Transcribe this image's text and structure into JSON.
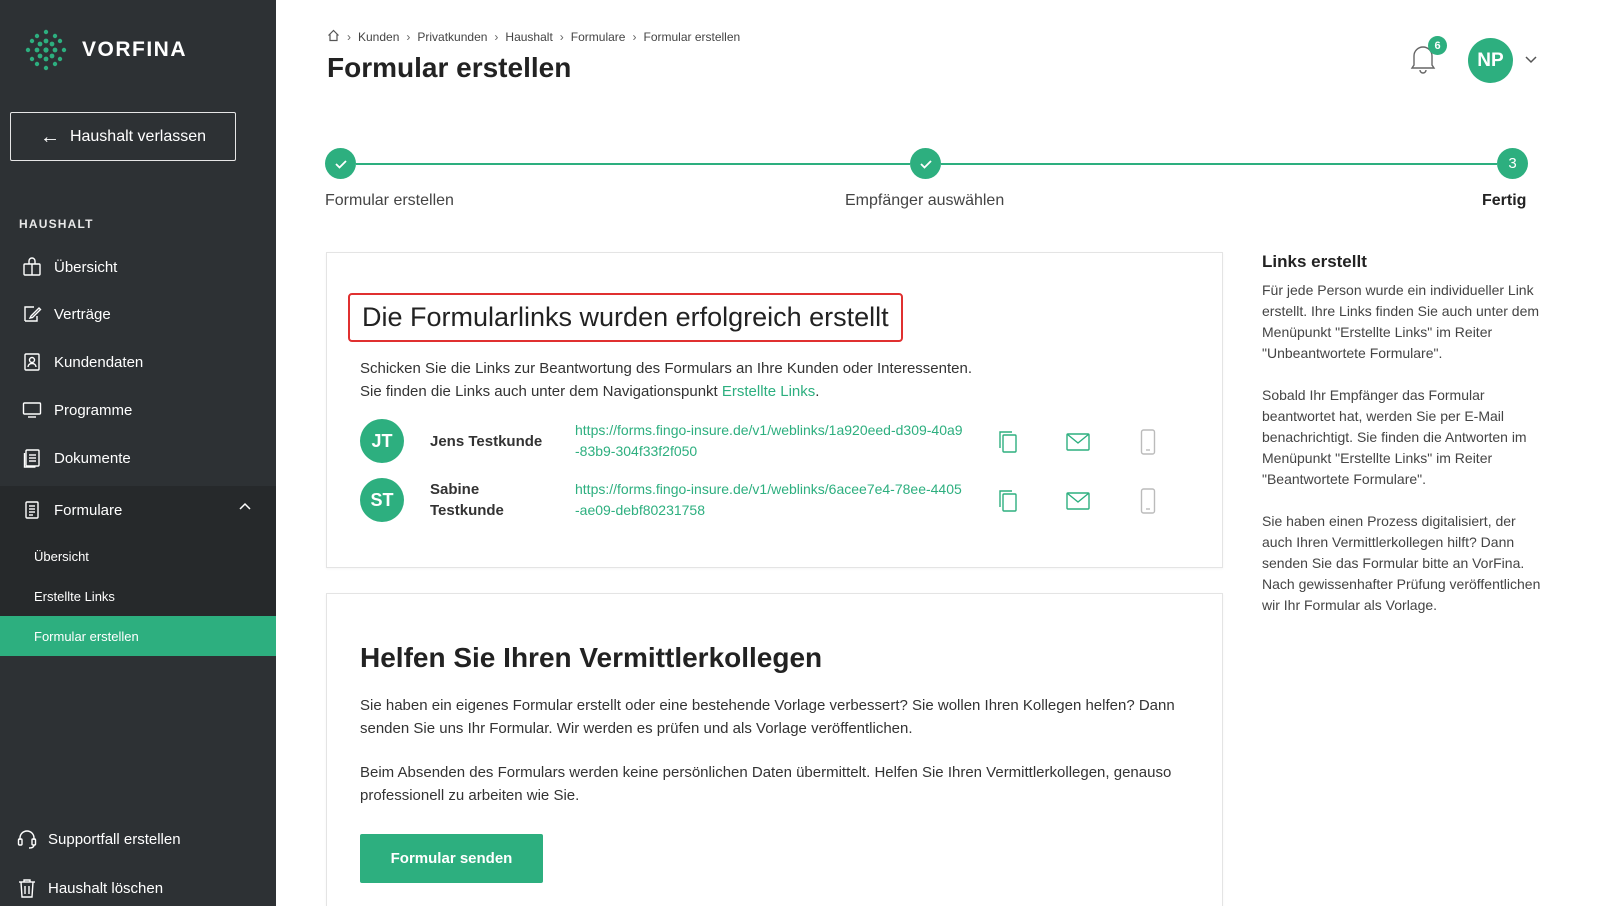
{
  "app": {
    "logo_text": "VORFINA"
  },
  "sidebar": {
    "leave_button": "Haushalt verlassen",
    "section_label": "HAUSHALT",
    "items": [
      {
        "label": "Übersicht",
        "icon": "overview-icon"
      },
      {
        "label": "Verträge",
        "icon": "contracts-icon"
      },
      {
        "label": "Kundendaten",
        "icon": "customer-data-icon"
      },
      {
        "label": "Programme",
        "icon": "monitor-icon"
      },
      {
        "label": "Dokumente",
        "icon": "documents-icon"
      },
      {
        "label": "Formulare",
        "icon": "forms-icon",
        "expanded": true
      }
    ],
    "sub_items": [
      {
        "label": "Übersicht",
        "active": false
      },
      {
        "label": "Erstellte Links",
        "active": false
      },
      {
        "label": "Formular erstellen",
        "active": true
      }
    ],
    "bottom": [
      {
        "label": "Supportfall erstellen",
        "icon": "headset-icon"
      },
      {
        "label": "Haushalt löschen",
        "icon": "trash-icon"
      }
    ]
  },
  "header": {
    "breadcrumb": [
      "Kunden",
      "Privatkunden",
      "Haushalt",
      "Formulare",
      "Formular erstellen"
    ],
    "title": "Formular erstellen",
    "notification_count": "6",
    "user_initials": "NP"
  },
  "stepper": {
    "steps": [
      {
        "label": "Formular erstellen",
        "state": "done"
      },
      {
        "label": "Empfänger auswählen",
        "state": "done"
      },
      {
        "label": "Fertig",
        "state": "current",
        "number": "3"
      }
    ]
  },
  "success_card": {
    "title": "Die Formularlinks wurden erfolgreich erstellt",
    "intro_line1": "Schicken Sie die Links zur Beantwortung des Formulars an Ihre Kunden oder Interessenten.",
    "intro_line2_prefix": "Sie finden die Links auch unter dem Navigationspunkt ",
    "intro_link": "Erstellte Links",
    "intro_line2_suffix": ".",
    "recipients": [
      {
        "initials": "JT",
        "name_line1": "Jens Testkunde",
        "name_line2": "",
        "link": "https://forms.fingo-insure.de/v1/weblinks/1a920eed-d309-40a9-83b9-304f33f2f050"
      },
      {
        "initials": "ST",
        "name_line1": "Sabine",
        "name_line2": "Testkunde",
        "link": "https://forms.fingo-insure.de/v1/weblinks/6acee7e4-78ee-4405-ae09-debf80231758"
      }
    ]
  },
  "help_card": {
    "title": "Helfen Sie Ihren Vermittlerkollegen",
    "paragraph1": "Sie haben ein eigenes Formular erstellt oder eine bestehende Vorlage verbessert? Sie wollen Ihren Kollegen helfen? Dann senden Sie uns Ihr Formular. Wir werden es prüfen und als Vorlage veröffentlichen.",
    "paragraph2": "Beim Absenden des Formulars werden keine persönlichen Daten übermittelt. Helfen Sie Ihren Vermittlerkollegen, genauso professionell zu arbeiten wie Sie.",
    "button": "Formular senden"
  },
  "info_panel": {
    "title": "Links erstellt",
    "paragraph1": "Für jede Person wurde ein individueller Link erstellt. Ihre Links finden Sie auch unter dem Menüpunkt \"Erstellte Links\" im Reiter \"Unbeantwortete Formulare\".",
    "paragraph2": "Sobald Ihr Empfänger das Formular beantwortet hat, werden Sie per E-Mail benachrichtigt. Sie finden die Antworten im Menüpunkt \"Erstellte Links\" im Reiter \"Beantwortete Formulare\".",
    "paragraph3": "Sie haben einen Prozess digitalisiert, der auch Ihren Vermittlerkollegen hilft? Dann senden Sie das Formular bitte an VorFina. Nach gewissenhafter Prüfung veröffentlichen wir Ihr Formular als Vorlage."
  },
  "colors": {
    "accent": "#2daf7f",
    "sidebar_bg": "#2d3134",
    "highlight_border": "#e03030"
  }
}
